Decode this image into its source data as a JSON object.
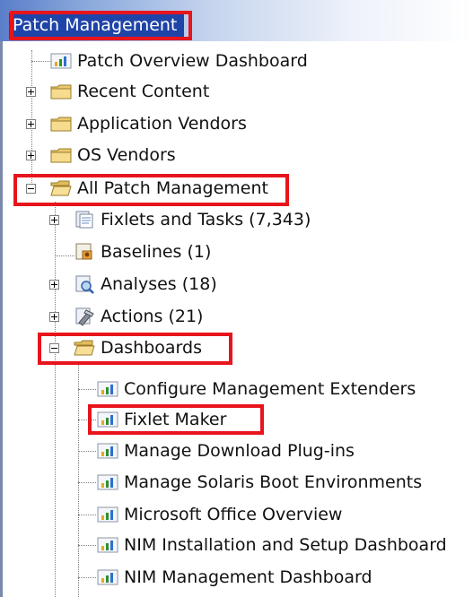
{
  "panel": {
    "title": "Patch Management"
  },
  "tree": {
    "items": [
      {
        "label": "Patch Overview Dashboard",
        "icon": "dashboard-icon"
      },
      {
        "label": "Recent Content",
        "icon": "folder-icon"
      },
      {
        "label": "Application Vendors",
        "icon": "folder-icon"
      },
      {
        "label": "OS Vendors",
        "icon": "folder-icon"
      },
      {
        "label": "All Patch Management",
        "icon": "folder-open-icon"
      },
      {
        "label": "Fixlets and Tasks (7,343)",
        "icon": "fixlets-icon"
      },
      {
        "label": "Baselines (1)",
        "icon": "baseline-icon"
      },
      {
        "label": "Analyses (18)",
        "icon": "analysis-icon"
      },
      {
        "label": "Actions (21)",
        "icon": "action-icon"
      },
      {
        "label": "Dashboards",
        "icon": "folder-open-icon"
      },
      {
        "label": "Configure Management Extenders",
        "icon": "dashboard-icon"
      },
      {
        "label": "Fixlet Maker",
        "icon": "dashboard-icon"
      },
      {
        "label": "Manage Download Plug-ins",
        "icon": "dashboard-icon"
      },
      {
        "label": "Manage Solaris Boot Environments",
        "icon": "dashboard-icon"
      },
      {
        "label": "Microsoft Office Overview",
        "icon": "dashboard-icon"
      },
      {
        "label": "NIM Installation and Setup Dashboard",
        "icon": "dashboard-icon"
      },
      {
        "label": "NIM Management Dashboard",
        "icon": "dashboard-icon"
      }
    ]
  },
  "colors": {
    "highlight": "#e8141c",
    "title_bg": "#1f44a8",
    "folder": "#e9c46a"
  }
}
